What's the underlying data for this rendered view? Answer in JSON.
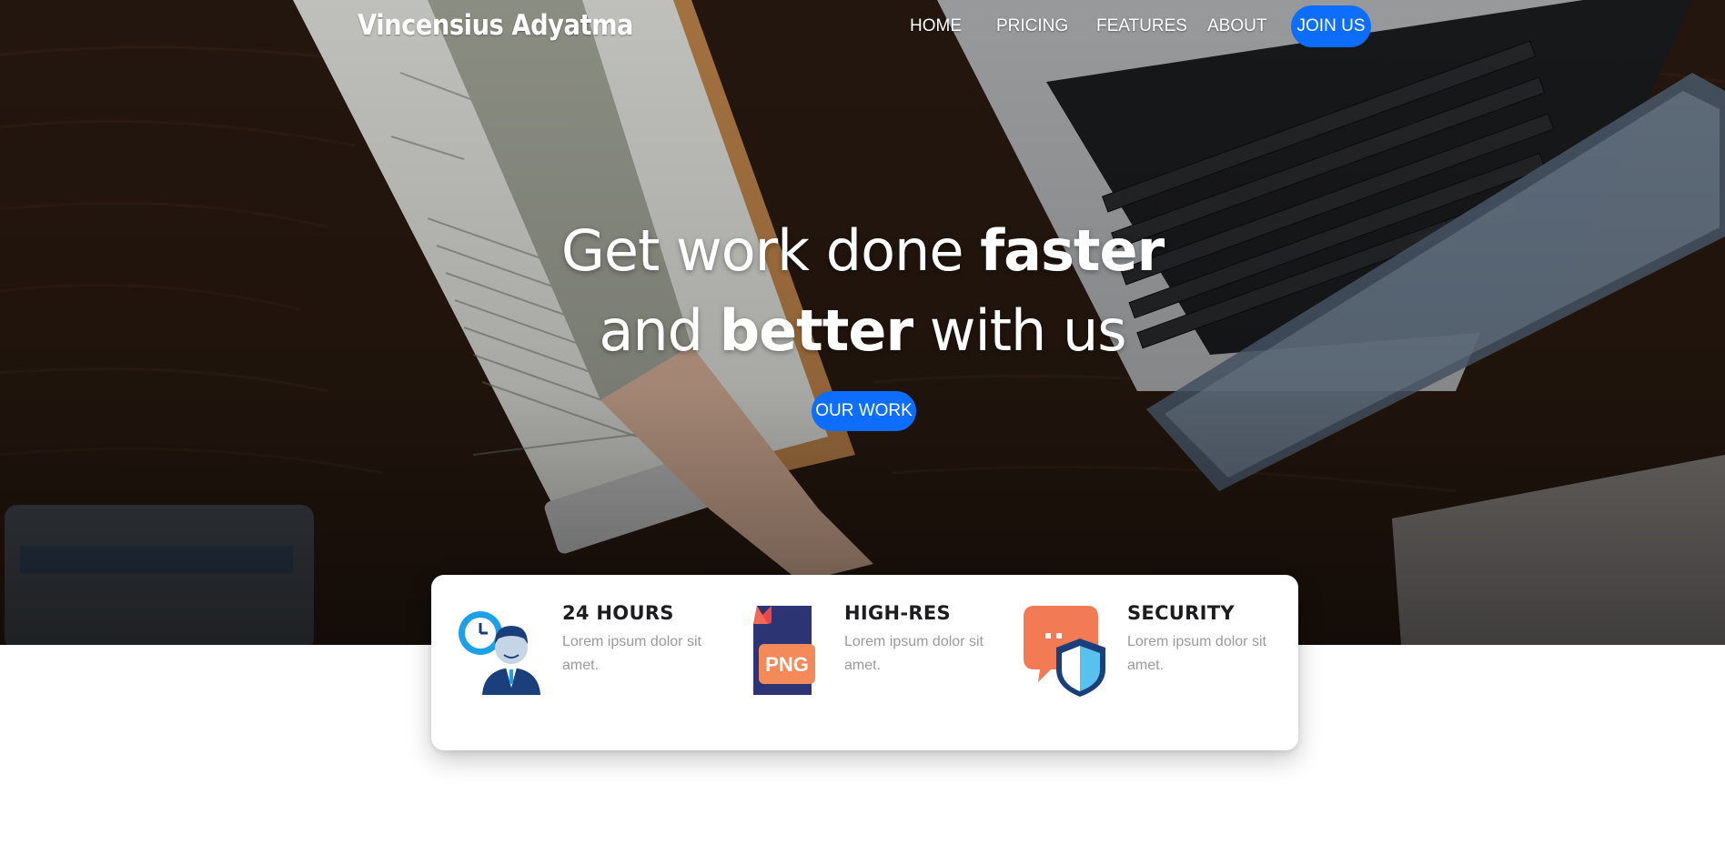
{
  "brand": "Vincensius Adyatma",
  "nav": {
    "items": [
      "HOME",
      "PRICING",
      "FEATURES",
      "ABOUT"
    ],
    "cta": "JOIN US"
  },
  "hero": {
    "line1_regular": "Get work done ",
    "line1_bold": "faster",
    "line2_regular_a": "and ",
    "line2_bold": "better",
    "line2_regular_b": " with us",
    "button": "OUR WORK"
  },
  "features": [
    {
      "title": "24 HOURS",
      "text": "Lorem ipsum dolor sit amet.",
      "icon": "support-clock-icon"
    },
    {
      "title": "HIGH-RES",
      "text": "Lorem ipsum dolor sit amet.",
      "icon": "png-file-icon",
      "badge": "PNG"
    },
    {
      "title": "SECURITY",
      "text": "Lorem ipsum dolor sit amet.",
      "icon": "shield-chat-icon"
    }
  ],
  "colors": {
    "accent": "#0d6efd",
    "title": "#1d1d1f",
    "muted": "#9a9a9a"
  }
}
